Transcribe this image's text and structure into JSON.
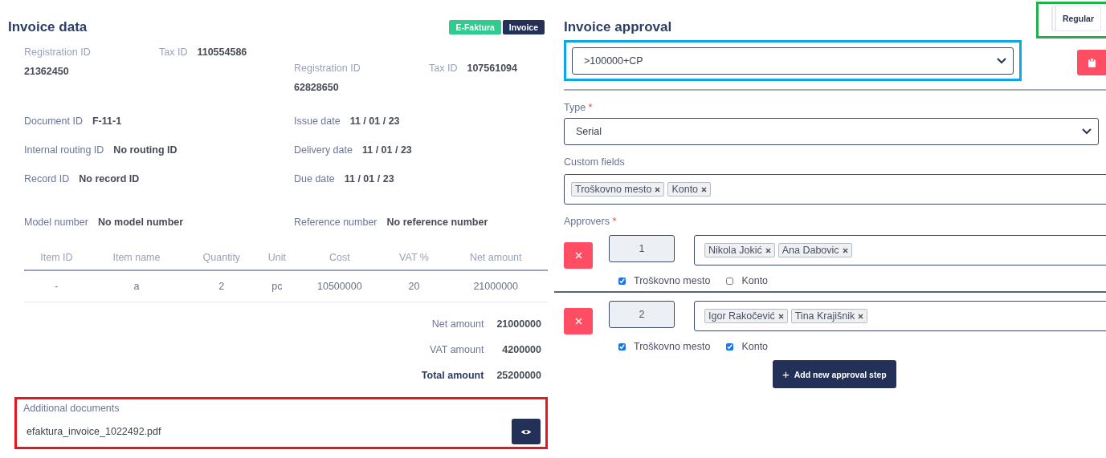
{
  "invoice_data": {
    "title": "Invoice data",
    "badges": [
      {
        "label": "E-Faktura",
        "color": "#2ecc8f"
      },
      {
        "label": "Invoice",
        "color": "#233159"
      }
    ],
    "parties": [
      {
        "registration_label": "Registration ID",
        "registration_value": "21362450",
        "tax_label": "Tax ID",
        "tax_value": "110554586"
      },
      {
        "registration_label": "Registration ID",
        "registration_value": "62828650",
        "tax_label": "Tax ID",
        "tax_value": "107561094"
      }
    ],
    "fields": [
      [
        {
          "label": "Document ID",
          "value": "F-11-1"
        },
        {
          "label": "Issue date",
          "value": "11 / 01 / 23"
        }
      ],
      [
        {
          "label": "Internal routing ID",
          "value": "No routing ID"
        },
        {
          "label": "Delivery date",
          "value": "11 / 01 / 23"
        }
      ],
      [
        {
          "label": "Record ID",
          "value": "No record ID"
        },
        {
          "label": "Due date",
          "value": "11 / 01 / 23"
        }
      ],
      [
        {
          "label": "Model number",
          "value": "No model number"
        },
        {
          "label": "Reference number",
          "value": "No reference number"
        }
      ]
    ],
    "table": {
      "columns": [
        "Item ID",
        "Item name",
        "Quantity",
        "Unit",
        "Cost",
        "VAT %",
        "Net amount"
      ],
      "rows": [
        [
          "-",
          "a",
          "2",
          "pc",
          "10500000",
          "20",
          "21000000"
        ]
      ]
    },
    "totals": [
      {
        "label": "Net amount",
        "value": "21000000",
        "bold": false
      },
      {
        "label": "VAT amount",
        "value": "4200000",
        "bold": false
      },
      {
        "label": "Total amount",
        "value": "25200000",
        "bold": true
      }
    ],
    "additional_documents": {
      "label": "Additional documents",
      "file": "efaktura_invoice_1022492.pdf",
      "color": "#e8161d"
    }
  },
  "invoice_approval": {
    "title": "Invoice approval",
    "mode_button": {
      "label": "Regular",
      "color": "#22b04a"
    },
    "workflow_select": {
      "value": ">100000+CP",
      "color": "#0ea5e9"
    },
    "type": {
      "label": "Type",
      "required_mark": "*",
      "value": "Serial"
    },
    "custom_fields": {
      "label": "Custom fields",
      "tags": [
        "Troškovno mesto",
        "Konto"
      ]
    },
    "approvers": {
      "label": "Approvers",
      "required_mark": "*",
      "steps": [
        {
          "order": "1",
          "approvers": [
            "Nikola Jokić",
            "Ana Dabovic"
          ],
          "options": [
            {
              "label": "Troškovno mesto",
              "checked": true
            },
            {
              "label": "Konto",
              "checked": false
            }
          ]
        },
        {
          "order": "2",
          "approvers": [
            "Igor Rakočević",
            "Tina Krajišnik"
          ],
          "options": [
            {
              "label": "Troškovno mesto",
              "checked": true
            },
            {
              "label": "Konto",
              "checked": true
            }
          ]
        }
      ]
    },
    "add_button": {
      "icon": "+",
      "label": "Add new approval step"
    }
  }
}
